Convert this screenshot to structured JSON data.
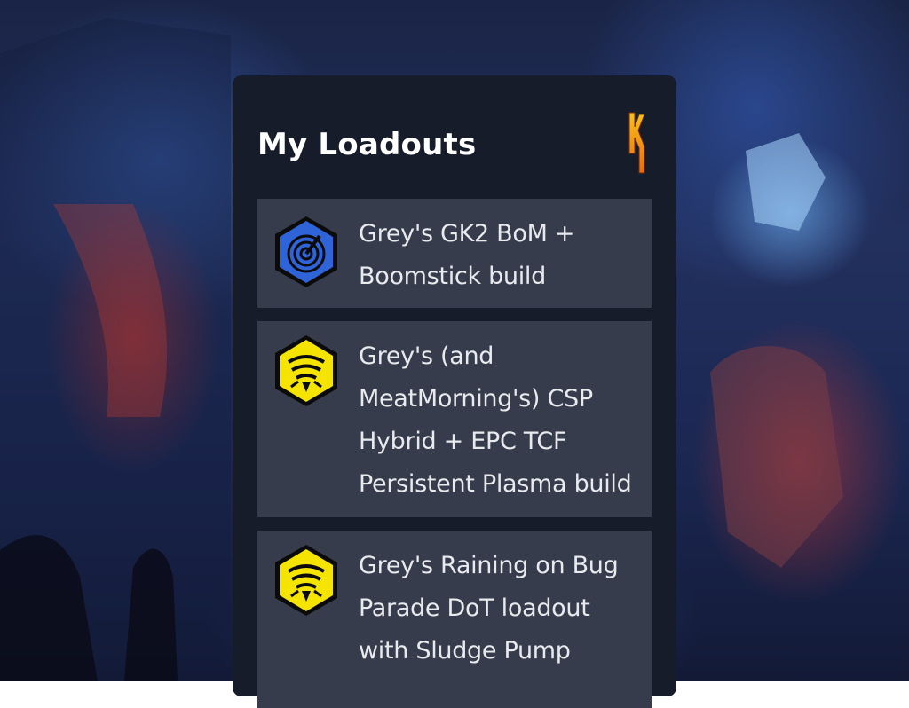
{
  "panel": {
    "title": "My Loadouts"
  },
  "loadouts": [
    {
      "title": "Grey's GK2 BoM + Boomstick build",
      "class_icon": "scout-radar-icon",
      "icon_color": "#2f63d8"
    },
    {
      "title": "Grey's (and MeatMorning's) CSP Hybrid + EPC TCF Persistent Plasma build",
      "class_icon": "engineer-driller-icon",
      "icon_color": "#f4e400"
    },
    {
      "title": "Grey's Raining on Bug Parade DoT loadout with Sludge Pump",
      "class_icon": "engineer-driller-icon",
      "icon_color": "#f4e400"
    }
  ],
  "colors": {
    "panel_bg": "#171c2b",
    "card_bg": "#363c4b",
    "logo_orange": "#f08a12"
  }
}
